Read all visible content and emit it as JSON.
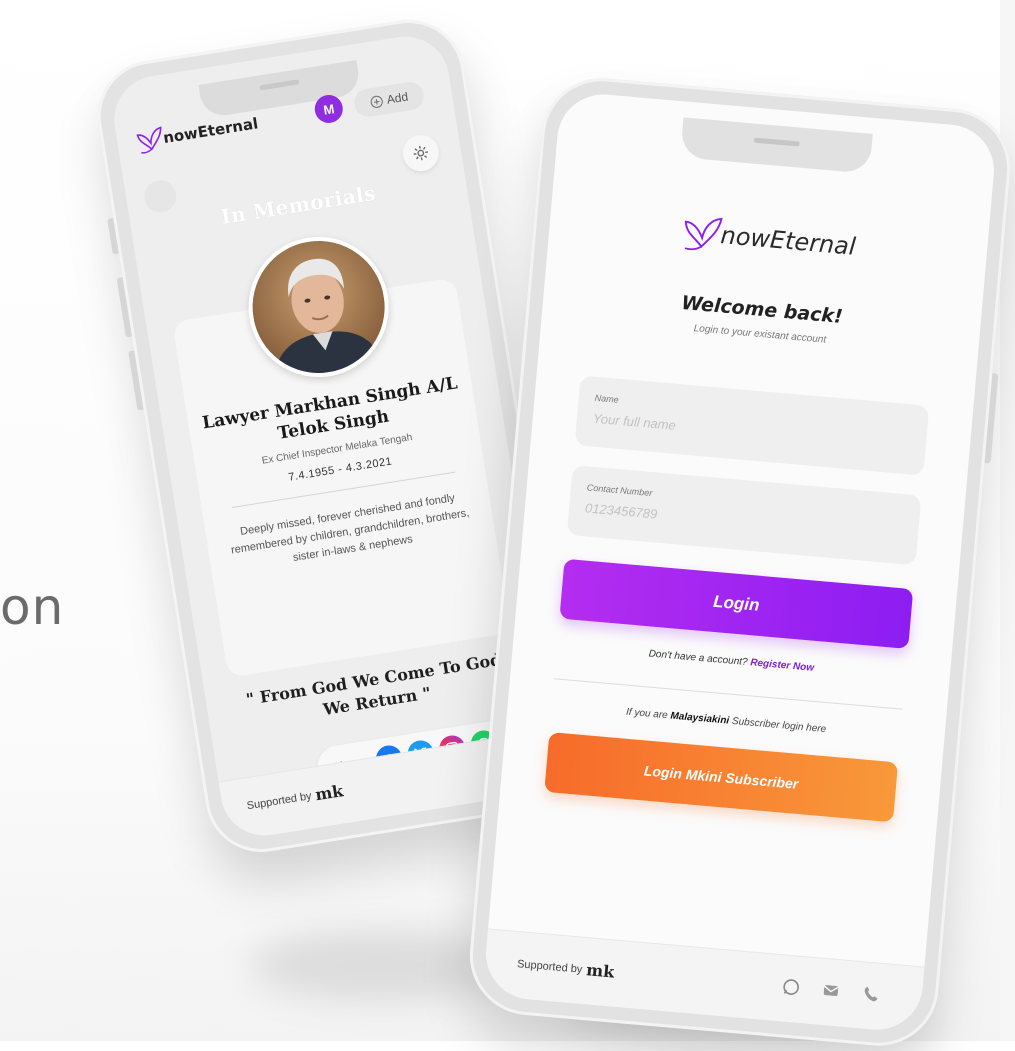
{
  "background": {
    "partial_text": "on"
  },
  "phone_left": {
    "header": {
      "logo_text": "nowEternal",
      "avatar_initial": "M",
      "add_label": "Add"
    },
    "page_title": "In Memorials",
    "profile": {
      "name": "Lawyer Markhan Singh A/L Telok Singh",
      "subtitle": "Ex Chief Inspector Melaka Tengah",
      "dates": "7.4.1955 - 4.3.2021",
      "message": "Deeply missed, forever cherished and fondly remembered by children, grandchildren, brothers, sister in-laws & nephews"
    },
    "quote": "\" From God We Come To God We Return \"",
    "share": {
      "label": "Share",
      "networks": [
        "facebook",
        "twitter",
        "instagram",
        "whatsapp"
      ]
    },
    "footer": {
      "supported_label": "Supported by",
      "brand": "mk"
    }
  },
  "phone_right": {
    "logo_text": "nowEternal",
    "welcome_title": "Welcome back!",
    "welcome_subtitle": "Login to your existant account",
    "fields": {
      "name": {
        "label": "Name",
        "placeholder": "Your full name"
      },
      "contact": {
        "label": "Contact Number",
        "placeholder": "0123456789"
      }
    },
    "login_button": "Login",
    "register": {
      "prefix": "Don't have a account?",
      "link": "Register Now"
    },
    "subscriber_note": {
      "prefix": "If you are",
      "brand": "Malaysiakini",
      "suffix": "Subscriber login here"
    },
    "mkini_button": "Login Mkini Subscriber",
    "footer": {
      "supported_label": "Supported by",
      "brand": "mk",
      "icons": [
        "whatsapp-icon",
        "mail-icon",
        "phone-icon"
      ]
    }
  },
  "colors": {
    "brand_purple": "#8d1df2",
    "brand_orange": "#f76b2a",
    "facebook": "#1877f2",
    "twitter": "#1d9bf0",
    "instagram": "#e1306c",
    "whatsapp": "#25d366"
  }
}
